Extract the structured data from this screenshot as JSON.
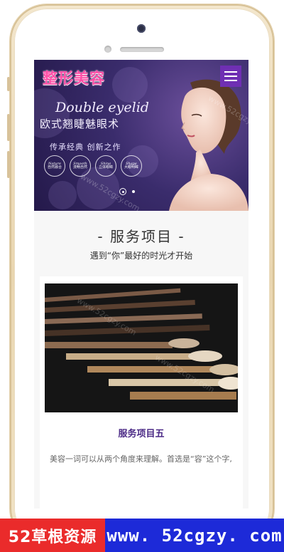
{
  "header": {
    "logo": "整形美容"
  },
  "banner": {
    "english_title": "Double eyelid",
    "chinese_title": "欧式翘睫魅眼术",
    "tagline": "传承经典  创新之作",
    "features": [
      {
        "en": "Nature",
        "cn": "自然融合"
      },
      {
        "en": "Smooth",
        "cn": "流畅自然"
      },
      {
        "en": "Shine",
        "cn": "立体眼睛"
      },
      {
        "en": "Shape",
        "cn": "大眼明眸"
      }
    ],
    "slide_count": 2,
    "active_slide": 1
  },
  "section": {
    "title": "- 服务项目 -",
    "subtitle": "遇到“你”最好的时光才开始"
  },
  "card": {
    "title": "服务项目五",
    "text": "美容一词可以从两个角度来理解。首选是“容”这个字,"
  },
  "watermark": "www.52cgzy.com",
  "ad": {
    "left": "52草根资源",
    "right": "www. 52cgzy. com"
  },
  "colors": {
    "accent": "#6f2fb3",
    "logo": "#ff4fa7",
    "card_title": "#4b2a86",
    "ad_red": "#ea2b2b",
    "ad_blue": "#1d2ad8"
  }
}
